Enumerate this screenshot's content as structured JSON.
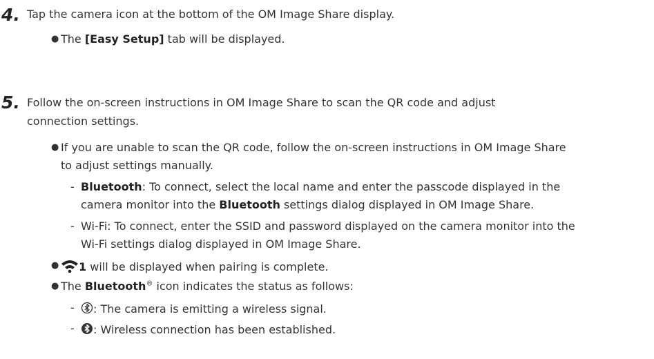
{
  "step4": {
    "number": "4.",
    "text": "Tap the camera icon at the bottom of the OM Image Share display.",
    "bullet1": {
      "strong": "[Easy Setup]",
      "rest": " tab will be displayed.",
      "pre": "The "
    }
  },
  "step5": {
    "number": "5.",
    "text_line1": "Follow the on-screen instructions in OM Image Share to scan the QR code and adjust",
    "text_line2": "connection settings.",
    "bullet1_line1": "If you are unable to scan the QR code, follow the on-screen instructions in OM Image Share",
    "bullet1_line2": "to adjust settings manually.",
    "sub_bluetooth": {
      "strong": "Bluetooth",
      "line1_rest": ": To connect, select the local name and enter the passcode displayed in the",
      "line2_pre": "camera monitor into the ",
      "line2_strong": "Bluetooth",
      "line2_rest": " settings dialog displayed in OM Image Share."
    },
    "sub_wifi": {
      "line1": "Wi-Fi: To connect, enter the SSID and password displayed on the camera monitor into the",
      "line2": "Wi-Fi settings dialog displayed in OM Image Share."
    },
    "bullet2": {
      "number": "1",
      "rest": " will be displayed when pairing is complete.",
      "icon": "wifi-icon"
    },
    "bullet3": {
      "pre": "The ",
      "strong": "Bluetooth",
      "reg": "®",
      "rest": " icon indicates the status as follows:"
    },
    "sub_emit": {
      "icon": "bluetooth-outline-icon",
      "text": ": The camera is emitting a wireless signal."
    },
    "sub_connected": {
      "icon": "bluetooth-filled-icon",
      "text": ": Wireless connection has been established."
    }
  }
}
